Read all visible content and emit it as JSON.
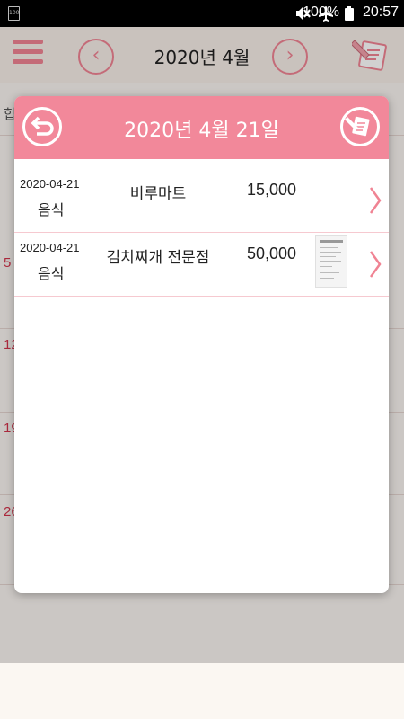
{
  "status_bar": {
    "notif_badge": "100",
    "battery_pct": "100%",
    "time": "20:57"
  },
  "header": {
    "title": "2020년 4월",
    "prev_icon": "chevron-left-icon",
    "next_icon": "chevron-right-icon",
    "menu_icon": "hamburger-icon",
    "memo_icon": "memo-pen-icon"
  },
  "calendar_background": {
    "left_edge_header": "합",
    "week_numbers": [
      "5",
      "12",
      "19",
      "26"
    ]
  },
  "dialog": {
    "title": "2020년 4월 21일",
    "back_icon": "back-arrow-icon",
    "write_icon": "memo-pen-icon",
    "entries": [
      {
        "date": "2020-04-21",
        "category": "음식",
        "store": "비루마트",
        "amount": "15,000",
        "has_receipt": false
      },
      {
        "date": "2020-04-21",
        "category": "음식",
        "store": "김치찌개 전문점",
        "amount": "50,000",
        "has_receipt": true
      }
    ]
  },
  "colors": {
    "accent": "#f2889a",
    "accent_dark": "#f08393",
    "row_divider": "#f6c9d0",
    "calendar_number": "#d2334b"
  }
}
